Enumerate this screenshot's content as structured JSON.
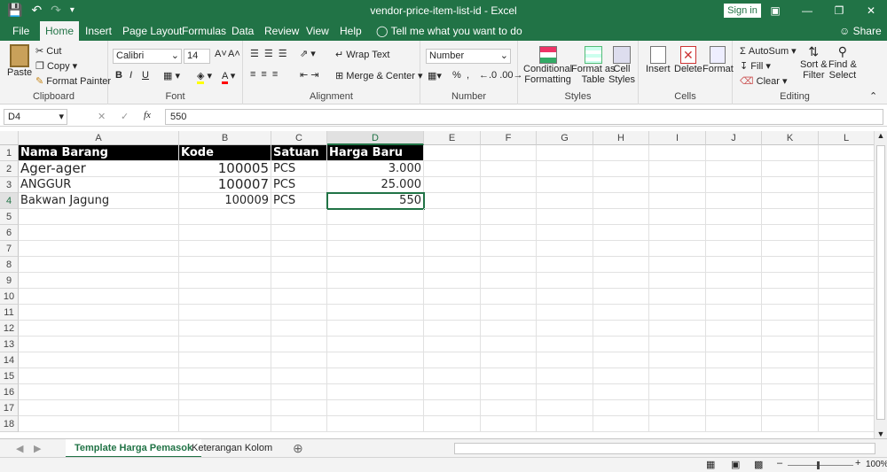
{
  "app": {
    "title": "vendor-price-item-list-id  -  Excel",
    "signin": "Sign in",
    "share": "Share",
    "tell_me": "Tell me what you want to do"
  },
  "tabs": [
    "File",
    "Home",
    "Insert",
    "Page Layout",
    "Formulas",
    "Data",
    "Review",
    "View",
    "Help"
  ],
  "ribbon": {
    "clipboard": {
      "label": "Clipboard",
      "paste": "Paste",
      "cut": "Cut",
      "copy": "Copy",
      "format_painter": "Format Painter"
    },
    "font": {
      "label": "Font",
      "family": "Calibri",
      "size": "14",
      "bold": "B",
      "italic": "I",
      "underline": "U"
    },
    "alignment": {
      "label": "Alignment",
      "wrap": "Wrap Text",
      "merge": "Merge & Center"
    },
    "number": {
      "label": "Number",
      "format": "Number",
      "percent": "%",
      "comma": ","
    },
    "styles": {
      "label": "Styles",
      "conditional": "Conditional",
      "conditional2": "Formatting",
      "format_as": "Format as",
      "format_as2": "Table",
      "cell_styles": "Cell",
      "cell_styles2": "Styles"
    },
    "cells": {
      "label": "Cells",
      "insert": "Insert",
      "delete": "Delete",
      "format": "Format"
    },
    "editing": {
      "label": "Editing",
      "autosum": "AutoSum",
      "fill": "Fill",
      "clear": "Clear",
      "sort": "Sort &",
      "sort2": "Filter",
      "find": "Find &",
      "find2": "Select"
    }
  },
  "formula_bar": {
    "name_box": "D4",
    "fx": "fx",
    "value": "550"
  },
  "columns": [
    "A",
    "B",
    "C",
    "D",
    "E",
    "F",
    "G",
    "H",
    "I",
    "J",
    "K",
    "L"
  ],
  "rows": [
    "1",
    "2",
    "3",
    "4",
    "5",
    "6",
    "7",
    "8",
    "9",
    "10",
    "11",
    "12",
    "13",
    "14",
    "15",
    "16",
    "17",
    "18"
  ],
  "cells": {
    "A1": "Nama Barang",
    "B1": "Kode",
    "C1": "Satuan",
    "D1": "Harga Baru",
    "A2": "Ager-ager",
    "B2": "100005",
    "C2": "PCS",
    "D2": "3.000",
    "A3": "ANGGUR",
    "B3": "100007",
    "C3": "PCS",
    "D3": "25.000",
    "A4": "Bakwan Jagung",
    "B4": "100009",
    "C4": "PCS",
    "D4": "550"
  },
  "sheets": [
    "Template Harga Pemasok",
    "Keterangan Kolom"
  ],
  "status": {
    "zoom": "100%"
  },
  "colors": {
    "accent": "#217346"
  }
}
